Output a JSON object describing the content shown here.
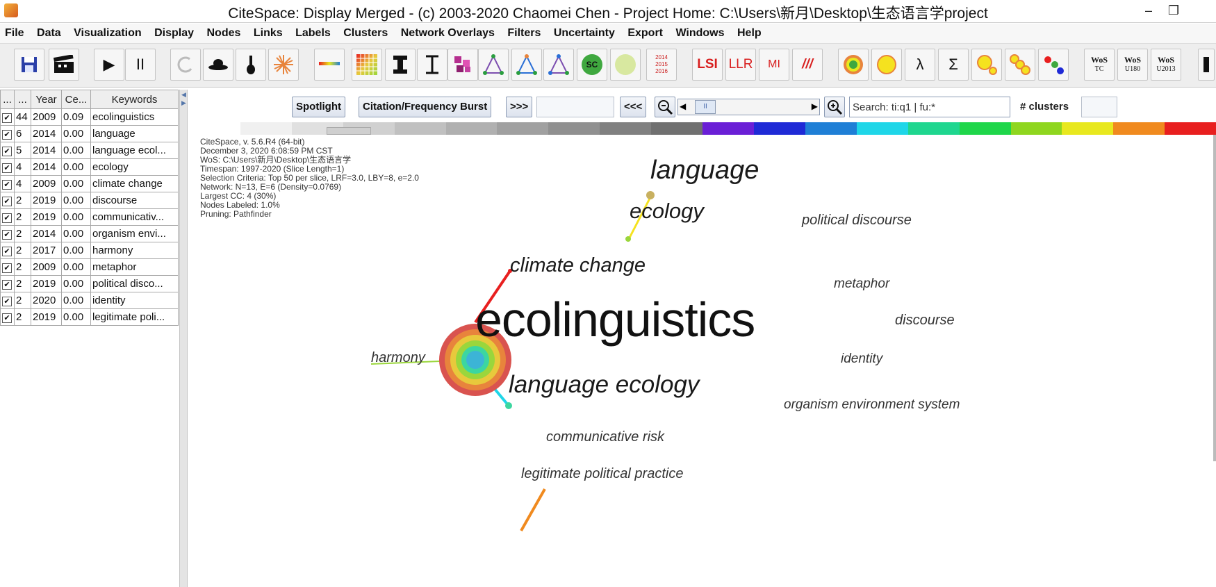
{
  "window": {
    "title": "CiteSpace: Display Merged - (c) 2003-2020 Chaomei Chen - Project Home: C:\\Users\\新月\\Desktop\\生态语言学project",
    "minimize": "–",
    "maximize": "❐"
  },
  "menu": [
    "File",
    "Data",
    "Visualization",
    "Display",
    "Nodes",
    "Links",
    "Labels",
    "Clusters",
    "Network Overlays",
    "Filters",
    "Uncertainty",
    "Export",
    "Windows",
    "Help"
  ],
  "toolbar": {
    "play": "▶",
    "pause": "II",
    "lsi": "LSI",
    "llr": "LLR",
    "mi": "MI",
    "slashes": "///",
    "lambda": "λ",
    "sigma": "Σ",
    "sc": "SC",
    "years": [
      "2014",
      "2015",
      "2016"
    ],
    "wos": [
      {
        "top": "WoS",
        "bottom": "TC"
      },
      {
        "top": "WoS",
        "bottom": "U180"
      },
      {
        "top": "WoS",
        "bottom": "U2013"
      }
    ]
  },
  "table": {
    "headers": [
      "...",
      "...",
      "Year",
      "Ce...",
      "Keywords"
    ],
    "rows": [
      {
        "count": "44",
        "year": "2009",
        "cent": "0.09",
        "kw": "ecolinguistics"
      },
      {
        "count": "6",
        "year": "2014",
        "cent": "0.00",
        "kw": "language"
      },
      {
        "count": "5",
        "year": "2014",
        "cent": "0.00",
        "kw": "language ecol..."
      },
      {
        "count": "4",
        "year": "2014",
        "cent": "0.00",
        "kw": "ecology"
      },
      {
        "count": "4",
        "year": "2009",
        "cent": "0.00",
        "kw": "climate change"
      },
      {
        "count": "2",
        "year": "2019",
        "cent": "0.00",
        "kw": "discourse"
      },
      {
        "count": "2",
        "year": "2019",
        "cent": "0.00",
        "kw": "communicativ..."
      },
      {
        "count": "2",
        "year": "2014",
        "cent": "0.00",
        "kw": "organism envi..."
      },
      {
        "count": "2",
        "year": "2017",
        "cent": "0.00",
        "kw": "harmony"
      },
      {
        "count": "2",
        "year": "2009",
        "cent": "0.00",
        "kw": "metaphor"
      },
      {
        "count": "2",
        "year": "2019",
        "cent": "0.00",
        "kw": "political disco..."
      },
      {
        "count": "2",
        "year": "2020",
        "cent": "0.00",
        "kw": "identity"
      },
      {
        "count": "2",
        "year": "2019",
        "cent": "0.00",
        "kw": "legitimate poli..."
      }
    ]
  },
  "controls": {
    "spotlight": "Spotlight",
    "burst": "Citation/Frequency Burst",
    "next": ">>>",
    "prev": "<<<",
    "search_value": "Search: ti:q1 | fu:*",
    "clusters_label": "# clusters",
    "slider_value": "II"
  },
  "info_lines": [
    "CiteSpace, v. 5.6.R4 (64-bit)",
    "December 3, 2020 6:08:59 PM CST",
    "WoS: C:\\Users\\新月\\Desktop\\生态语言学",
    "Timespan: 1997-2020 (Slice Length=1)",
    "Selection Criteria: Top 50 per slice, LRF=3.0, LBY=8, e=2.0",
    "Network: N=13, E=6 (Density=0.0769)",
    "Largest CC: 4 (30%)",
    "Nodes Labeled: 1.0%",
    "Pruning: Pathfinder"
  ],
  "network_labels": {
    "ecolinguistics": "ecolinguistics",
    "language": "language",
    "ecology": "ecology",
    "political_discourse": "political discourse",
    "climate_change": "climate change",
    "metaphor": "metaphor",
    "discourse": "discourse",
    "harmony": "harmony",
    "identity": "identity",
    "language_ecology": "language ecology",
    "organism_environment_system": "organism environment system",
    "communicative_risk": "communicative risk",
    "legitimate_political_practice": "legitimate political practice"
  },
  "colors": {
    "timeline": [
      "#ffffff",
      "#f0f0f0",
      "#e0e0e0",
      "#d0d0d0",
      "#c0c0c0",
      "#b0b0b0",
      "#a0a0a0",
      "#909090",
      "#808080",
      "#707070",
      "#6a1fd6",
      "#1f2ad6",
      "#1f7fd6",
      "#1fd6e8",
      "#1fd68f",
      "#1fd64a",
      "#8fd61f",
      "#e8e81f",
      "#f08a1f",
      "#e81f1f"
    ],
    "ring": [
      "#d9534f",
      "#e8843c",
      "#e8c93c",
      "#9ad63c",
      "#3cd6a0",
      "#3cb4d6"
    ]
  }
}
